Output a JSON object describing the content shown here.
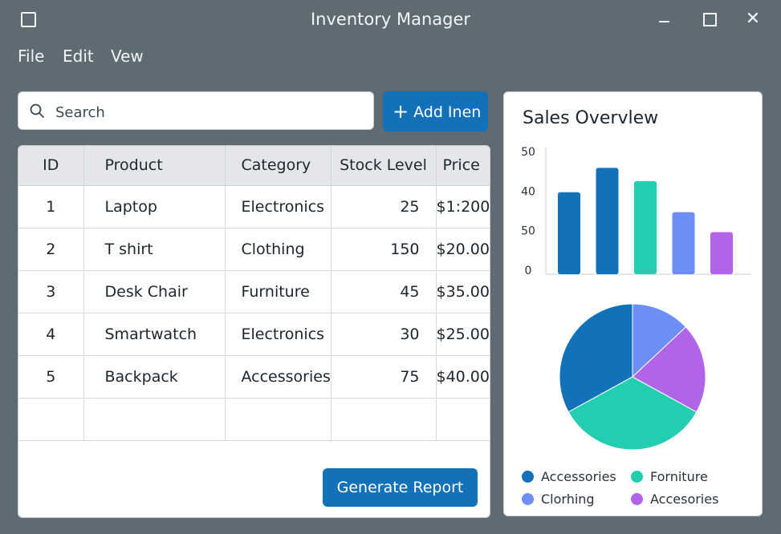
{
  "window": {
    "title": "Inventory Manager",
    "close_glyph": "✕"
  },
  "menu": [
    "File",
    "Edit",
    "Vew"
  ],
  "search": {
    "placeholder": "Search"
  },
  "toolbar": {
    "add_label": "Add Inen"
  },
  "table": {
    "headers": [
      "ID",
      "Product",
      "Category",
      "Stock Level",
      "Price"
    ],
    "rows": [
      [
        "1",
        "Laptop",
        "Electronics",
        "25",
        "$1:200"
      ],
      [
        "2",
        "T shirt",
        "Clothing",
        "150",
        "$20.00"
      ],
      [
        "3",
        "Desk Chair",
        "Furniture",
        "45",
        "$35.00"
      ],
      [
        "4",
        "Smartwatch",
        "Electronics",
        "30",
        "$25.00"
      ],
      [
        "5",
        "Backpack",
        "Accessories",
        "75",
        "$40.00"
      ]
    ]
  },
  "actions": {
    "generate_label": "Generate Report"
  },
  "sales": {
    "title": "Sales Overvlew",
    "legend": [
      {
        "label": "Accessories",
        "color": "#1271b8"
      },
      {
        "label": "Forniture",
        "color": "#23cdb0"
      },
      {
        "label": "Clorhing",
        "color": "#6d8ef5"
      },
      {
        "label": "Accesories",
        "color": "#b164e8"
      }
    ]
  },
  "chart_data": [
    {
      "type": "bar",
      "categories": [
        "",
        "",
        "",
        "",
        ""
      ],
      "values": [
        37,
        48,
        42,
        28,
        19
      ],
      "colors": [
        "#1271b8",
        "#1271b8",
        "#23cdb0",
        "#6d8ef5",
        "#b164e8"
      ],
      "ytick_labels": [
        "0",
        "50",
        "40",
        "50"
      ],
      "ylim": [
        0,
        55
      ],
      "grid": false
    },
    {
      "type": "pie",
      "values": [
        33,
        34,
        20,
        13
      ],
      "colors": [
        "#1271b8",
        "#23cdb0",
        "#b164e8",
        "#6d8ef5"
      ]
    }
  ]
}
